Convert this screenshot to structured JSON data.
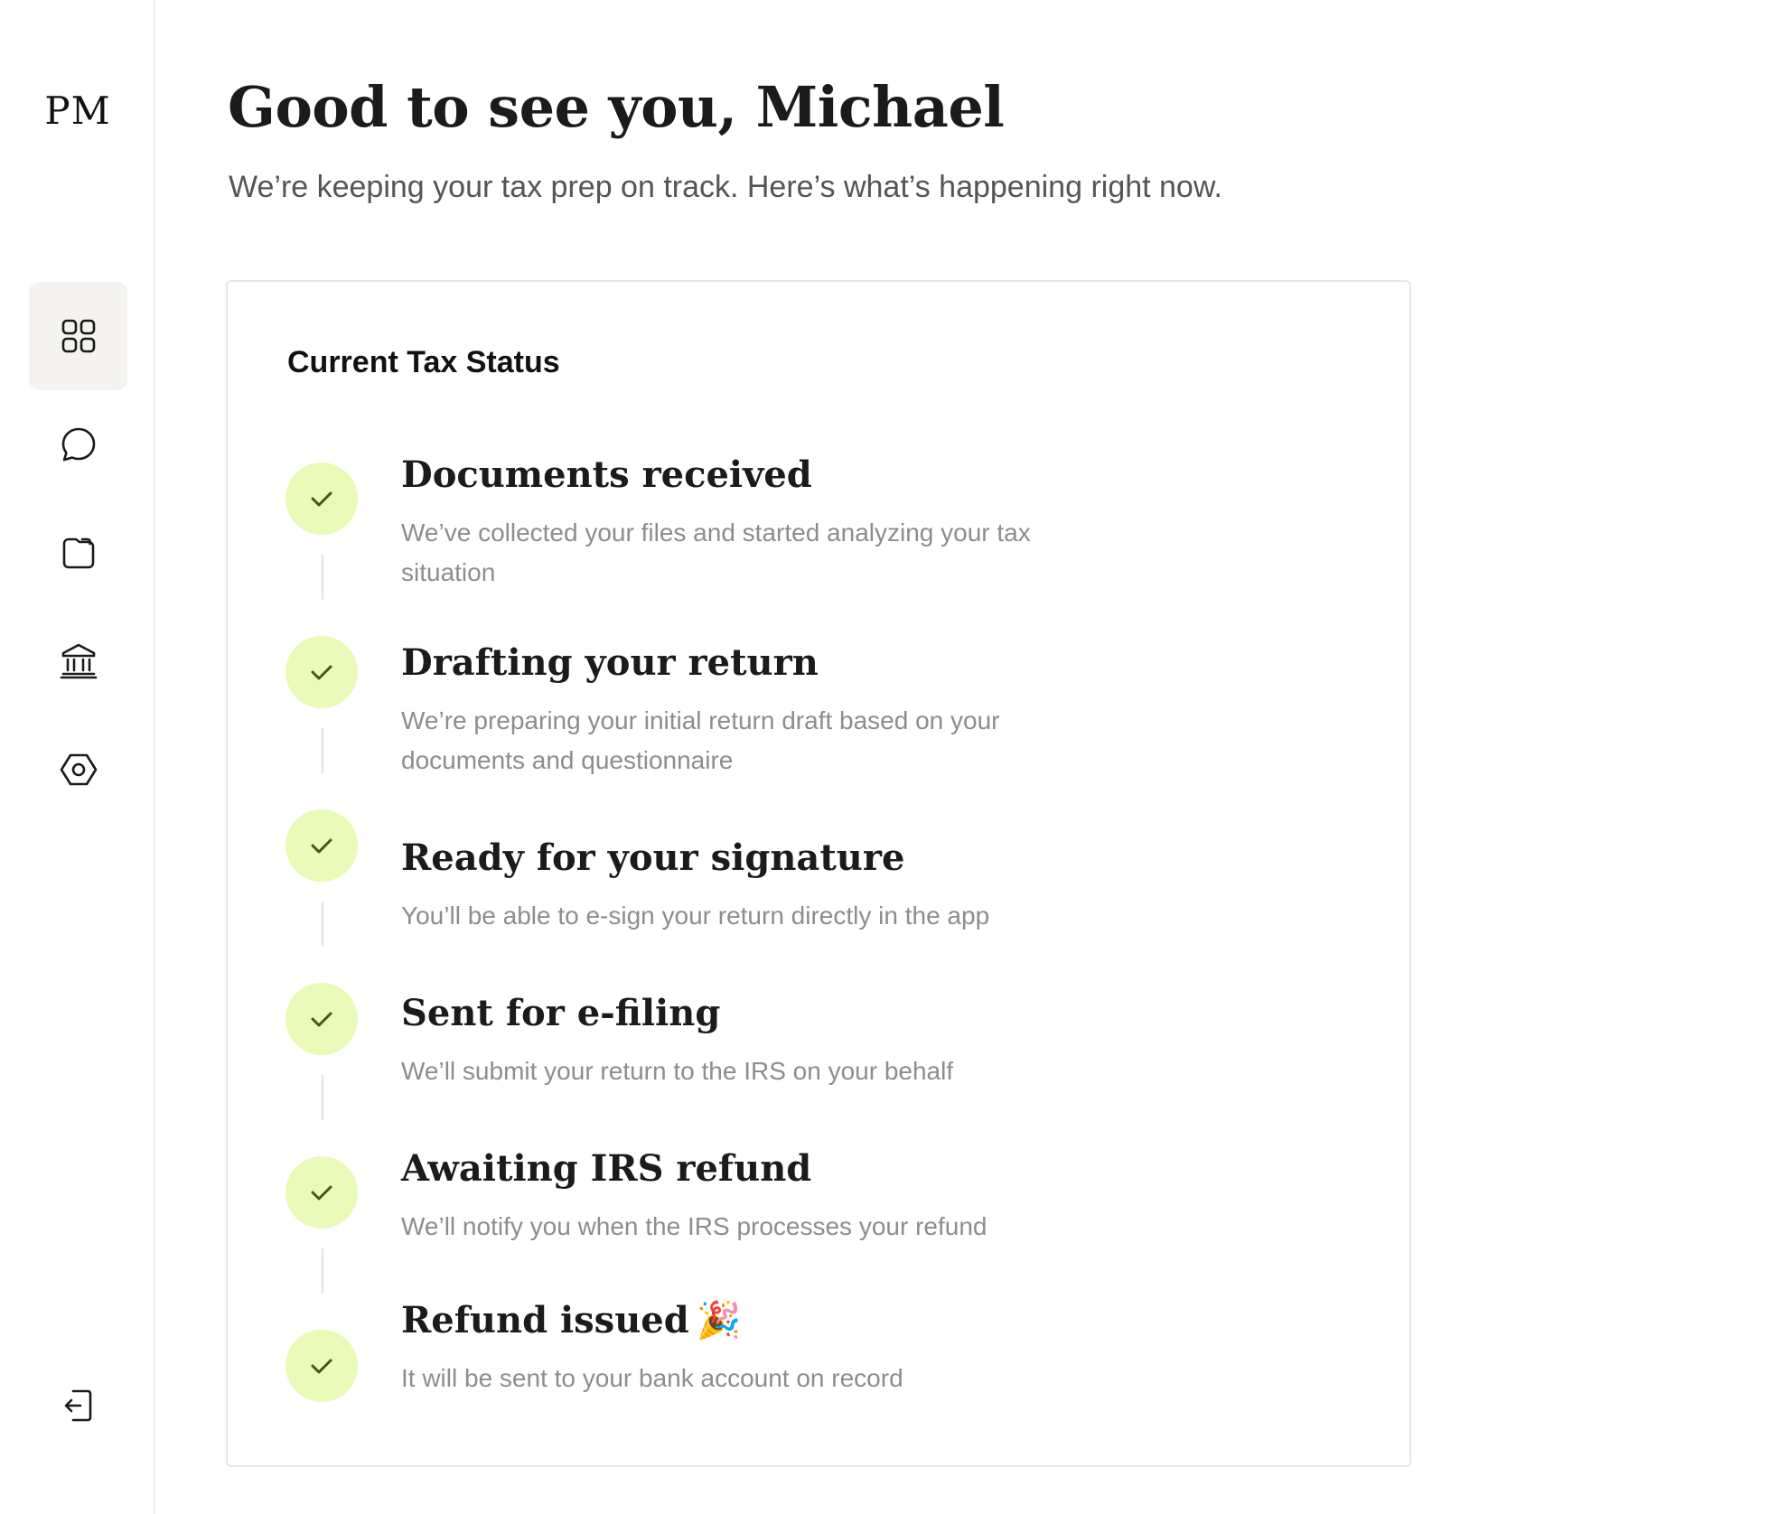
{
  "sidebar": {
    "logo": "PM",
    "nav": [
      {
        "icon": "dashboard-grid-icon",
        "active": true
      },
      {
        "icon": "chat-bubble-icon",
        "active": false
      },
      {
        "icon": "folder-icon",
        "active": false
      },
      {
        "icon": "bank-icon",
        "active": false
      },
      {
        "icon": "settings-hexagon-icon",
        "active": false
      }
    ],
    "logout_icon": "logout-icon"
  },
  "header": {
    "greeting": "Good to see you, Michael",
    "subtitle": "We’re keeping your tax prep on track. Here’s what’s happening right now."
  },
  "status_card": {
    "title": "Current Tax Status",
    "steps": [
      {
        "title": "Documents received",
        "description": "We’ve collected your files and started analyzing your tax situation",
        "completed": true
      },
      {
        "title": "Drafting your return",
        "description": "We’re preparing your initial return draft based on your documents and questionnaire",
        "completed": true
      },
      {
        "title": "Ready for your signature",
        "description": "You’ll be able to e-sign your return directly in the app",
        "completed": true
      },
      {
        "title": "Sent for e-filing",
        "description": "We’ll submit your return to the IRS on your behalf",
        "completed": true
      },
      {
        "title": "Awaiting IRS refund",
        "description": "We’ll notify you when the IRS processes your refund",
        "completed": true
      },
      {
        "title": "Refund issued",
        "description": "It will be sent to your bank account on record",
        "completed": true,
        "emoji": "🎉"
      }
    ]
  },
  "colors": {
    "check_bg": "#eafab8",
    "check_stroke": "#3d5a1a",
    "active_nav_bg": "#f4f3f0",
    "muted_text": "#8d8d8d"
  }
}
